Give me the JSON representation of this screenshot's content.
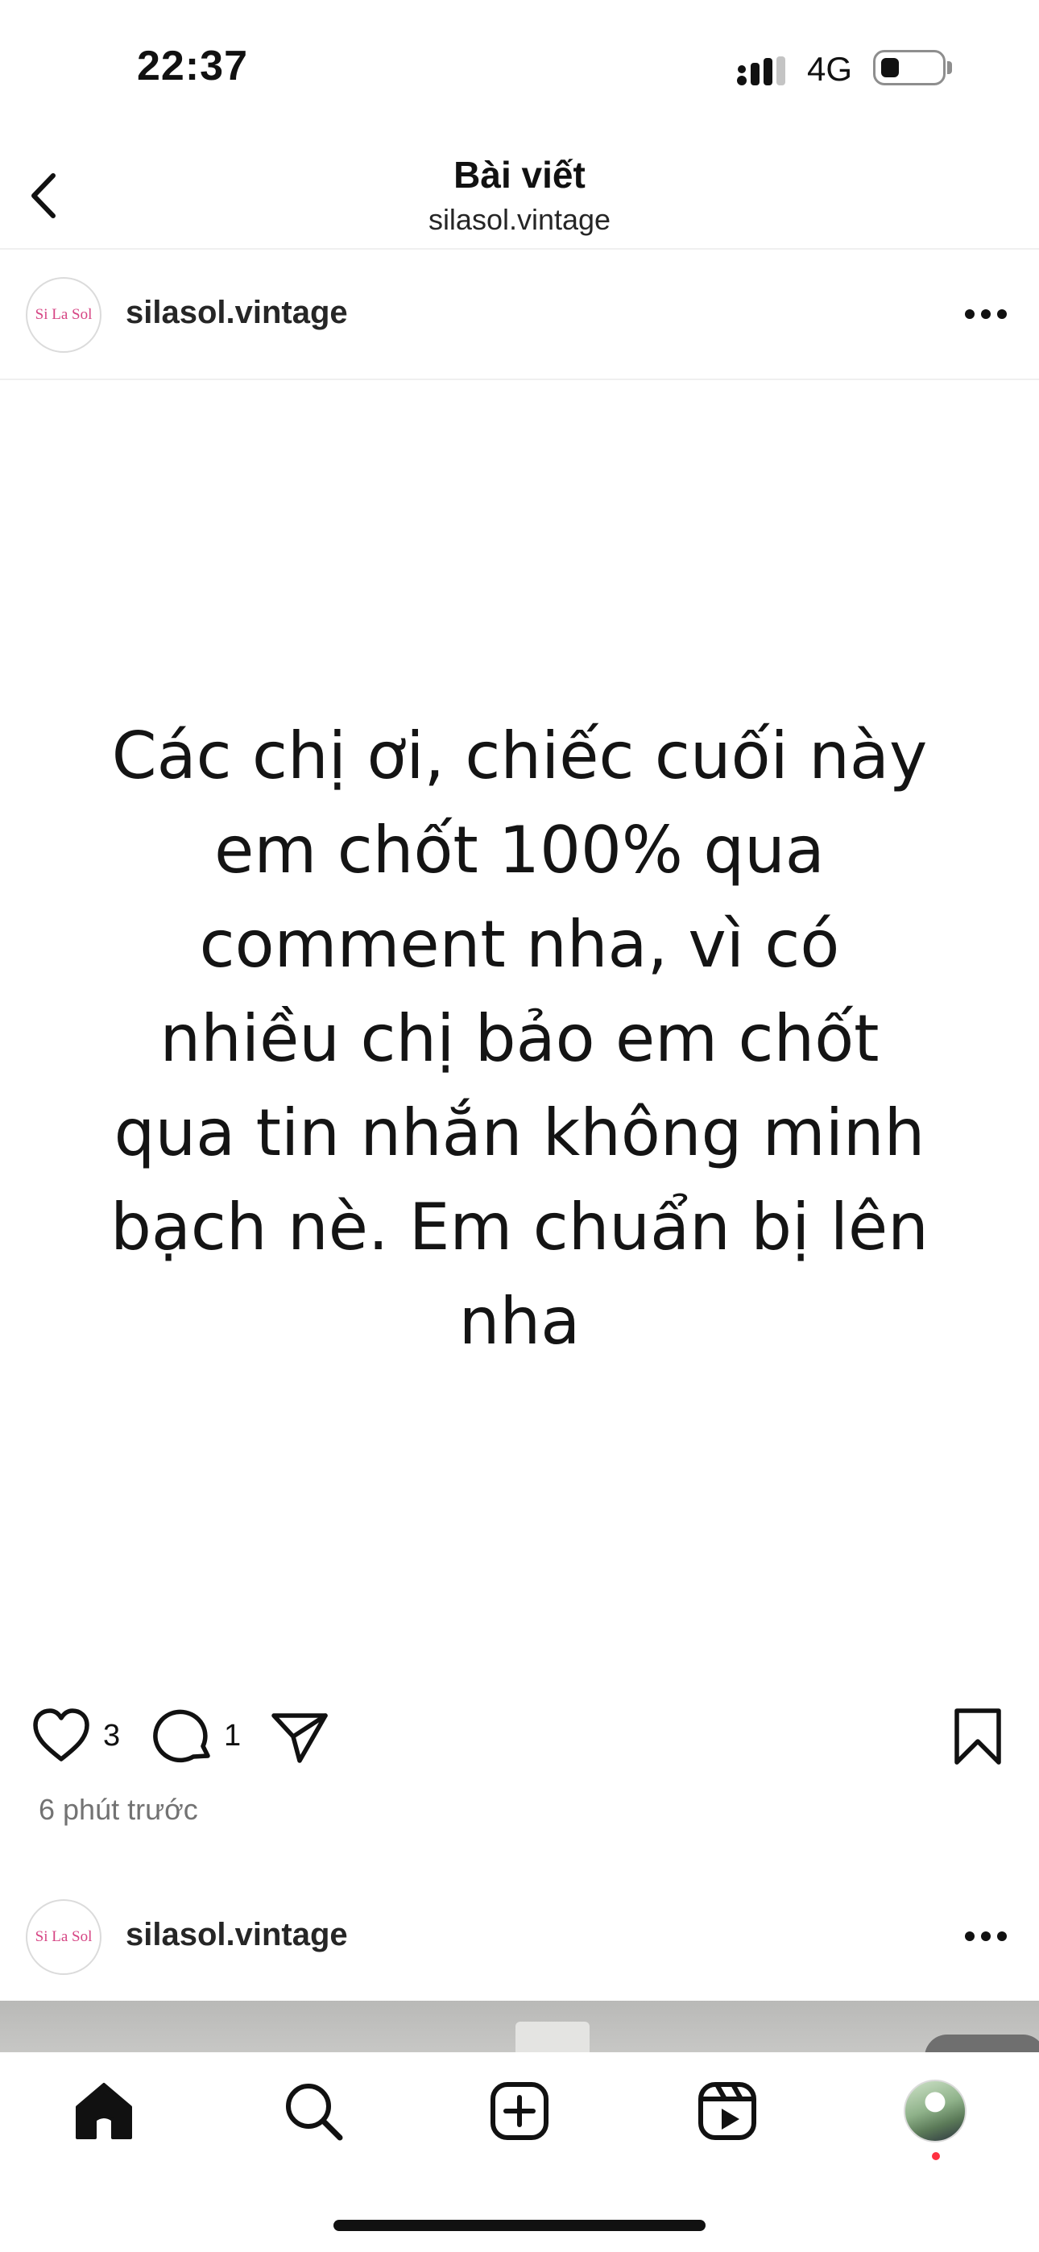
{
  "status_bar": {
    "time": "22:37",
    "network": "4G"
  },
  "header": {
    "title": "Bài viết",
    "subtitle": "silasol.vintage"
  },
  "post": {
    "avatar_text": "Si La Sol",
    "username": "silasol.vintage",
    "text": "Các chị ơi, chiếc cuối này\nem chốt 100% qua\ncomment nha, vì có\nnhiều chị bảo em chốt\nqua tin nhắn không minh\nbạch nè. Em chuẩn bị lên\nnha",
    "likes": "3",
    "comments": "1",
    "timestamp": "6 phút trước"
  },
  "next_post": {
    "avatar_text": "Si La Sol",
    "username": "silasol.vintage"
  },
  "tab_bar": {
    "items": [
      "home-icon",
      "search-icon",
      "create-icon",
      "reels-icon",
      "profile-avatar"
    ],
    "notification_color": "#ff3040"
  }
}
